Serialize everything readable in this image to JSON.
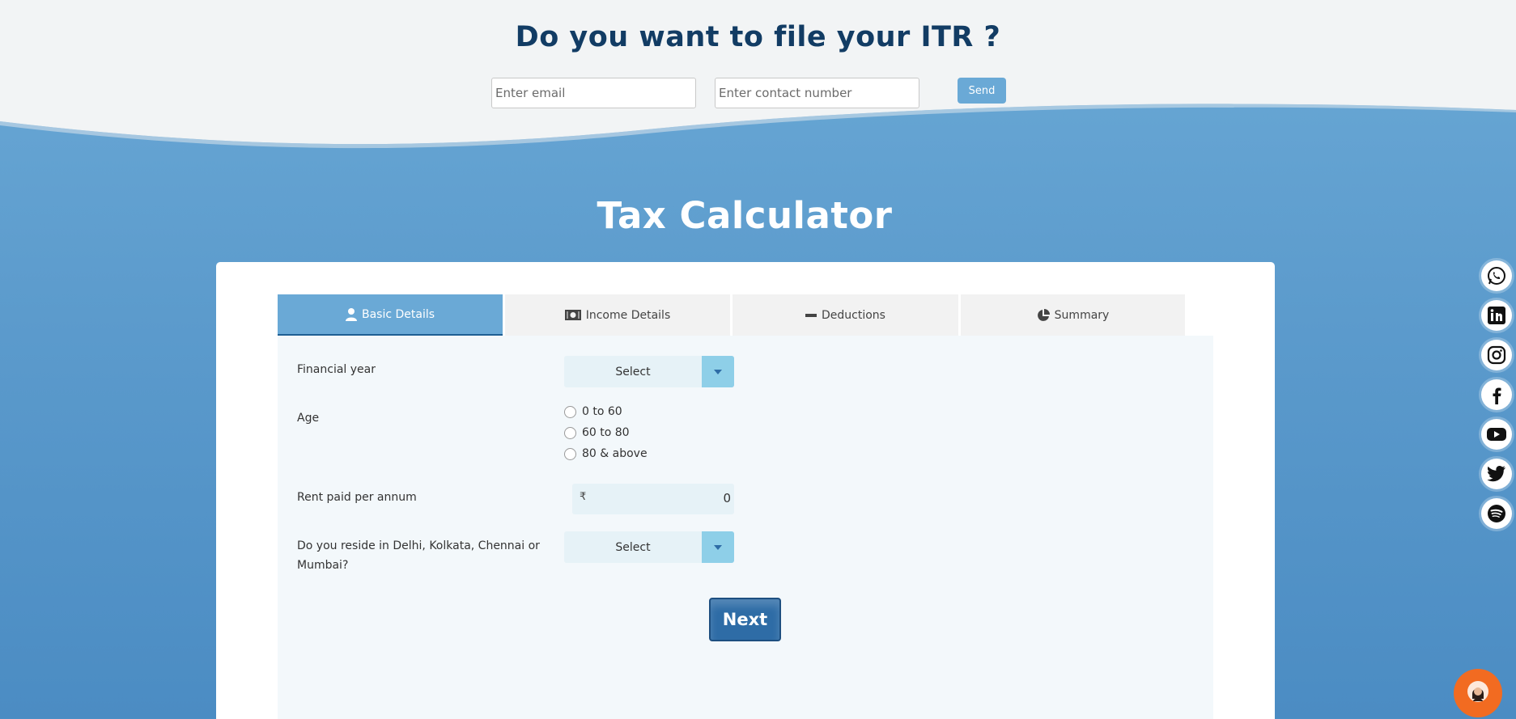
{
  "itr_section": {
    "title": "Do you want to file your ITR ?",
    "email_placeholder": "Enter email",
    "contact_placeholder": "Enter contact number",
    "send_label": "Send"
  },
  "calculator": {
    "title": "Tax Calculator",
    "tabs": [
      {
        "label": "Basic Details",
        "icon": "user-icon",
        "active": true
      },
      {
        "label": "Income Details",
        "icon": "money-icon",
        "active": false
      },
      {
        "label": "Deductions",
        "icon": "minus-icon",
        "active": false
      },
      {
        "label": "Summary",
        "icon": "pie-chart-icon",
        "active": false
      }
    ],
    "form": {
      "financial_year_label": "Financial year",
      "financial_year_value": "Select",
      "age_label": "Age",
      "age_options": [
        "0 to 60",
        "60 to 80",
        "80 & above"
      ],
      "rent_label": "Rent paid per annum",
      "rent_currency": "₹",
      "rent_value": "0",
      "metro_label_line1": "Do you reside in Delhi, Kolkata, Chennai or",
      "metro_label_line2": "Mumbai?",
      "metro_value": "Select"
    },
    "next_label": "Next"
  },
  "social_links": [
    "whatsapp-icon",
    "linkedin-icon",
    "instagram-icon",
    "facebook-icon",
    "youtube-icon",
    "twitter-icon",
    "spotify-icon"
  ],
  "colors": {
    "primary_blue": "#6aa9d6",
    "dark_navy": "#123c64",
    "next_button": "#2e6ca6",
    "chat_orange": "#f26b21"
  }
}
